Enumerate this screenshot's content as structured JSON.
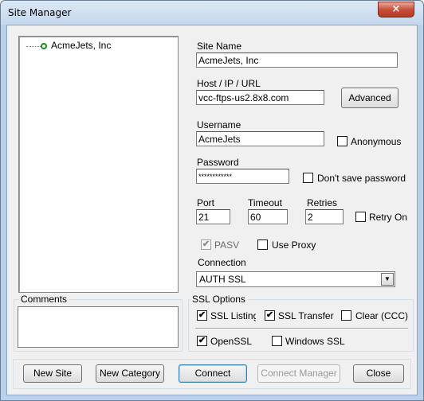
{
  "window": {
    "title": "Site Manager",
    "close_glyph": "×"
  },
  "tree": {
    "items": [
      {
        "label": "AcmeJets, Inc",
        "icon": "site-node-icon"
      }
    ]
  },
  "comments": {
    "title": "Comments",
    "value": ""
  },
  "site": {
    "site_name_label": "Site Name",
    "site_name_value": "AcmeJets, Inc",
    "host_label": "Host / IP / URL",
    "host_value": "vcc-ftps-us2.8x8.com",
    "advanced_label": "Advanced",
    "username_label": "Username",
    "username_value": "AcmeJets",
    "anonymous_label": "Anonymous",
    "anonymous_checked": false,
    "password_label": "Password",
    "password_value": "************",
    "dont_save_label": "Don't save password",
    "dont_save_checked": false,
    "port_label": "Port",
    "port_value": "21",
    "timeout_label": "Timeout",
    "timeout_value": "60",
    "retries_label": "Retries",
    "retries_value": "2",
    "retry_on_label": "Retry On",
    "retry_on_checked": false,
    "pasv_label": "PASV",
    "pasv_checked": true,
    "use_proxy_label": "Use Proxy",
    "use_proxy_checked": false,
    "connection_label": "Connection",
    "connection_value": "AUTH SSL"
  },
  "ssl": {
    "title": "SSL Options",
    "listings_label": "SSL Listings",
    "listings_checked": true,
    "transfer_label": "SSL Transfer",
    "transfer_checked": true,
    "clear_label": "Clear (CCC)",
    "clear_checked": false,
    "openssl_label": "OpenSSL",
    "openssl_checked": true,
    "windows_ssl_label": "Windows SSL",
    "windows_ssl_checked": false
  },
  "buttons": {
    "new_site": "New Site",
    "new_category": "New Category",
    "connect": "Connect",
    "connect_manager": "Connect Manager",
    "close": "Close"
  },
  "glyphs": {
    "check": "✔",
    "dropdown": "▼"
  }
}
